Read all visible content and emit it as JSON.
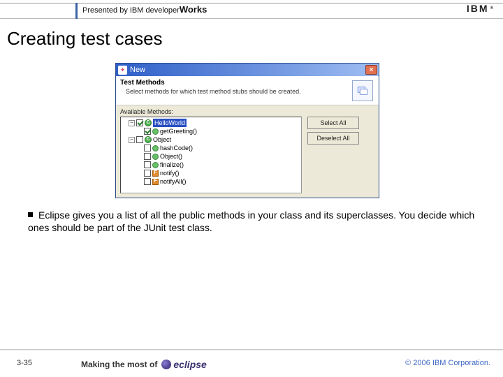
{
  "header": {
    "presented_prefix": "Presented by IBM ",
    "dw1": "developer",
    "dw2": "Works",
    "ibm_brand": "IBM",
    "reg": "®"
  },
  "title": "Creating test cases",
  "dialog": {
    "window_title": "New",
    "close_glyph": "×",
    "banner_title": "Test Methods",
    "banner_sub": "Select methods for which test method stubs should be created.",
    "avail_label": "Available Methods:",
    "buttons": {
      "select_all": "Select All",
      "deselect_all": "Deselect All"
    },
    "tree": {
      "class1": "HelloWorld",
      "class1_method": "getGreeting()",
      "class2": "Object",
      "obj_methods": [
        "hashCode()",
        "Object()",
        "finalize()",
        "notify()",
        "notifyAll()"
      ]
    }
  },
  "bullet": "Eclipse gives you a list of all the public methods in your class and its superclasses. You decide which ones should be part of the JUnit test class.",
  "footer": {
    "page": "3-35",
    "making_prefix": "Making the most of",
    "eclipse_word": "eclipse",
    "copyright": "© 2006 IBM Corporation."
  }
}
